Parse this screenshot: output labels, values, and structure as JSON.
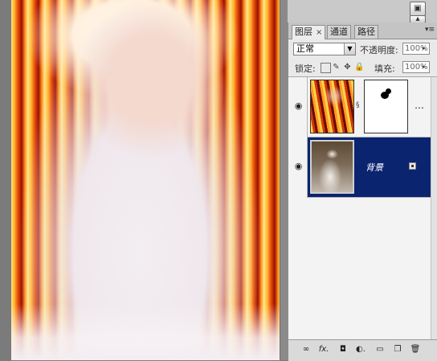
{
  "panel": {
    "tabs": [
      {
        "label": "图层",
        "close": "×"
      },
      {
        "label": "通道"
      },
      {
        "label": "路径"
      }
    ],
    "blend_mode": "正常",
    "opacity_label": "不透明度:",
    "opacity_value": "100%",
    "lock_label": "锁定:",
    "fill_label": "填充:",
    "fill_value": "100%"
  },
  "layers": [
    {
      "name": "",
      "type": "fire-with-mask",
      "selected": false
    },
    {
      "name": "背景",
      "type": "background-photo",
      "selected": true
    }
  ],
  "colors": {
    "selection": "#0b2470",
    "panel_bg": "#e9e9e9",
    "canvas_bg": "#7b7b7b"
  },
  "icons": {
    "footer": [
      "link-icon",
      "fx-icon",
      "mask-icon",
      "adjustment-icon",
      "group-icon",
      "new-layer-icon",
      "trash-icon"
    ]
  }
}
